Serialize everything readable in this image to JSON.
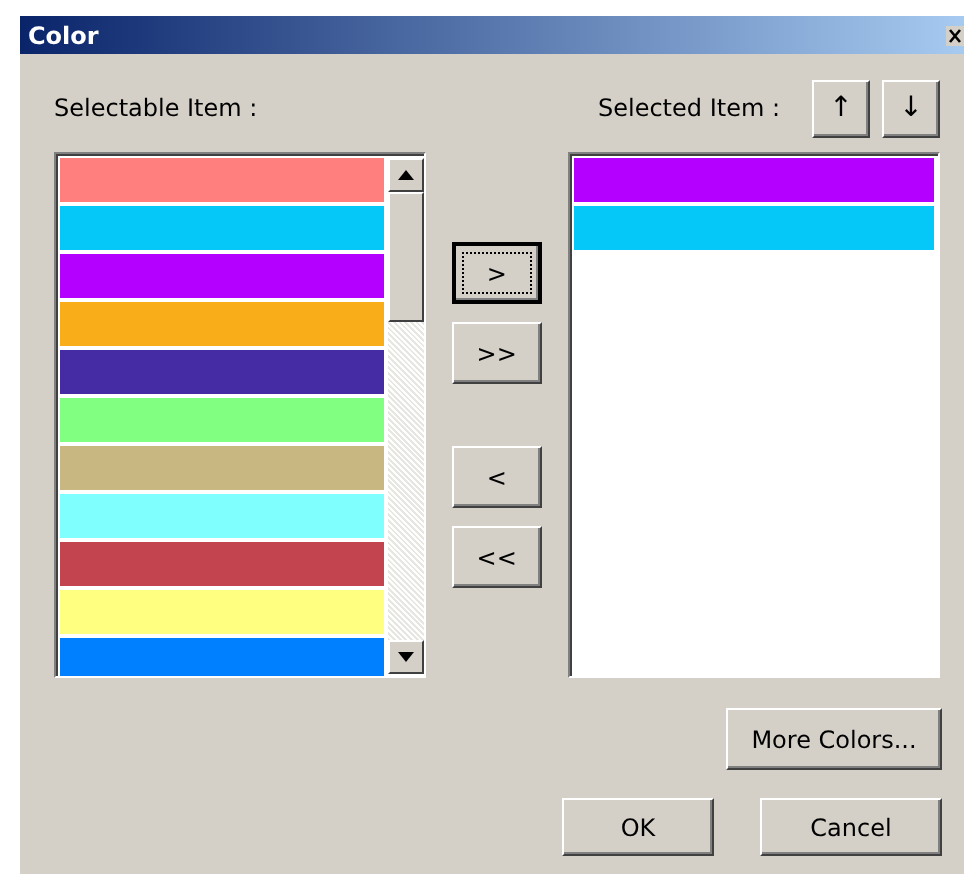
{
  "window": {
    "title": "Color"
  },
  "selectable": {
    "label": "Selectable Item :",
    "items": [
      {
        "color": "#ff7f7f"
      },
      {
        "color": "#06c8f8"
      },
      {
        "color": "#b400ff"
      },
      {
        "color": "#f9ae19"
      },
      {
        "color": "#452ca4"
      },
      {
        "color": "#80ff80"
      },
      {
        "color": "#c8b780"
      },
      {
        "color": "#80ffff"
      },
      {
        "color": "#c3444f"
      },
      {
        "color": "#ffff80"
      },
      {
        "color": "#0080ff"
      }
    ]
  },
  "selected": {
    "label": "Selected Item :",
    "items": [
      {
        "color": "#b400ff"
      },
      {
        "color": "#06c8f8"
      }
    ]
  },
  "order_buttons": [
    "↑",
    "↓"
  ],
  "move_buttons": [
    {
      "label": ">",
      "focused": true
    },
    {
      "label": ">>",
      "focused": false
    },
    {
      "label": "<",
      "focused": false
    },
    {
      "label": "<<",
      "focused": false
    }
  ],
  "more_button": "More Colors...",
  "buttons": [
    "OK",
    "Cancel"
  ]
}
